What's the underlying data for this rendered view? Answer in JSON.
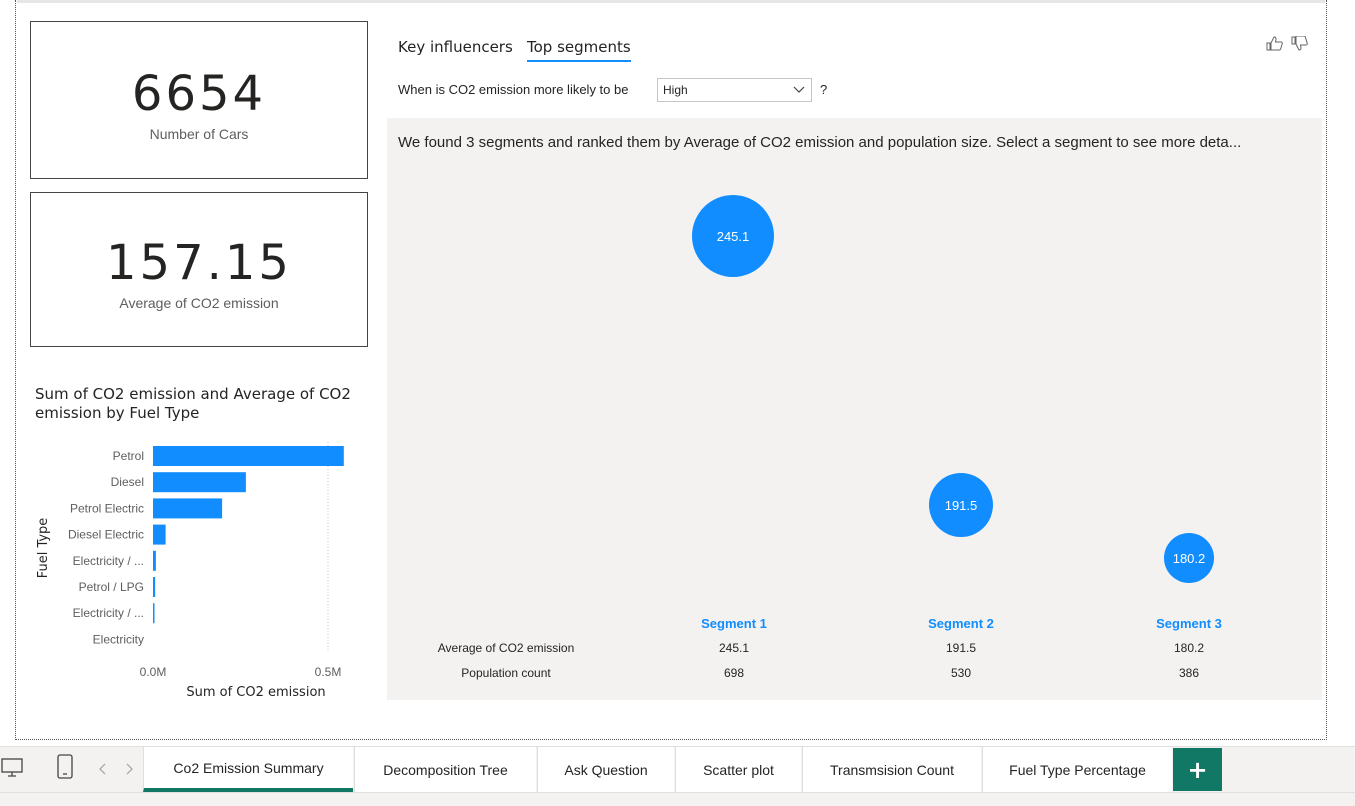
{
  "cards": [
    {
      "value": "6654",
      "label": "Number of Cars"
    },
    {
      "value": "157.15",
      "label": "Average of CO2 emission"
    }
  ],
  "bar_chart": {
    "title": "Sum of CO2 emission and Average of CO2 emission by Fuel Type"
  },
  "chart_data": {
    "type": "bar",
    "orientation": "horizontal",
    "title": "Sum of CO2 emission and Average of CO2 emission by Fuel Type",
    "xlabel": "Sum of CO2 emission",
    "ylabel": "Fuel Type",
    "categories": [
      "Petrol",
      "Diesel",
      "Petrol Electric",
      "Diesel Electric",
      "Electricity / ...",
      "Petrol / LPG",
      "Electricity / ...",
      "Electricity"
    ],
    "values": [
      530000,
      258000,
      192000,
      35000,
      8000,
      6000,
      3000,
      0
    ],
    "xlim": [
      0,
      600000
    ],
    "x_ticks": [
      "0.0M",
      "0.5M"
    ],
    "bar_color": "#118dff",
    "grid": true
  },
  "visual": {
    "tabs": [
      "Key influencers",
      "Top segments"
    ],
    "active_tab": "Top segments",
    "question_prefix": "When is CO2 emission more likely to be",
    "dropdown_value": "High",
    "question_suffix": "?",
    "description": "We found 3 segments and ranked them by Average of CO2 emission and population size. Select a segment to see more deta...",
    "segments": [
      {
        "name": "Segment 1",
        "avg": "245.1",
        "count": "698"
      },
      {
        "name": "Segment 2",
        "avg": "191.5",
        "count": "530"
      },
      {
        "name": "Segment 3",
        "avg": "180.2",
        "count": "386"
      }
    ],
    "row_labels": [
      "Average of CO2 emission",
      "Population count"
    ],
    "accent": "#118dff"
  },
  "pages": {
    "tabs": [
      "Co2 Emission Summary",
      "Decomposition Tree",
      "Ask Question",
      "Scatter plot",
      "Transmsision Count",
      "Fuel Type Percentage"
    ],
    "active": "Co2 Emission Summary",
    "add_label": "+",
    "accent": "#117865"
  }
}
